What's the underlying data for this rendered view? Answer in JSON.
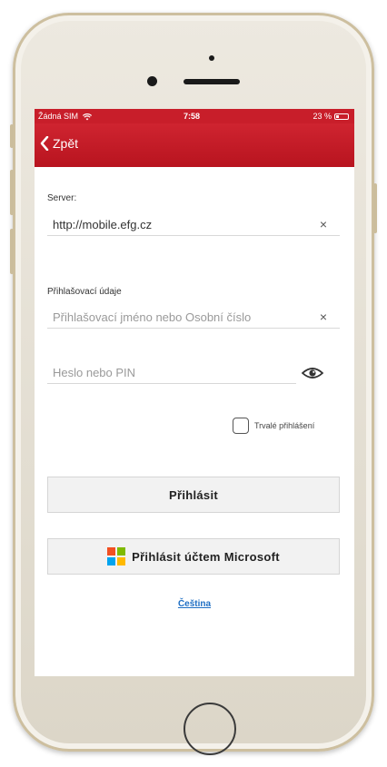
{
  "status_bar": {
    "carrier": "Žádná SIM",
    "time": "7:58",
    "battery": "23 %"
  },
  "nav": {
    "back_label": "Zpět"
  },
  "server": {
    "label": "Server:",
    "value": "http://mobile.efg.cz",
    "clear": "×"
  },
  "credentials": {
    "label": "Přihlašovací údaje",
    "username_placeholder": "Přihlašovací jméno nebo Osobní číslo",
    "password_placeholder": "Heslo nebo PIN",
    "clear": "×"
  },
  "remember": {
    "label": "Trvalé přihlášení",
    "checked": false
  },
  "buttons": {
    "login": "Přihlásit",
    "microsoft_login": "Přihlásit účtem Microsoft"
  },
  "language_link": "Čeština",
  "colors": {
    "header_red": "#c81e2a",
    "link_blue": "#1f6fc4",
    "ms_red": "#f25022",
    "ms_green": "#7fba00",
    "ms_blue": "#00a4ef",
    "ms_yellow": "#ffb900"
  },
  "icons": [
    "wifi-icon",
    "battery-icon",
    "back-chevron-icon",
    "clear-icon",
    "eye-icon",
    "microsoft-logo-icon"
  ]
}
